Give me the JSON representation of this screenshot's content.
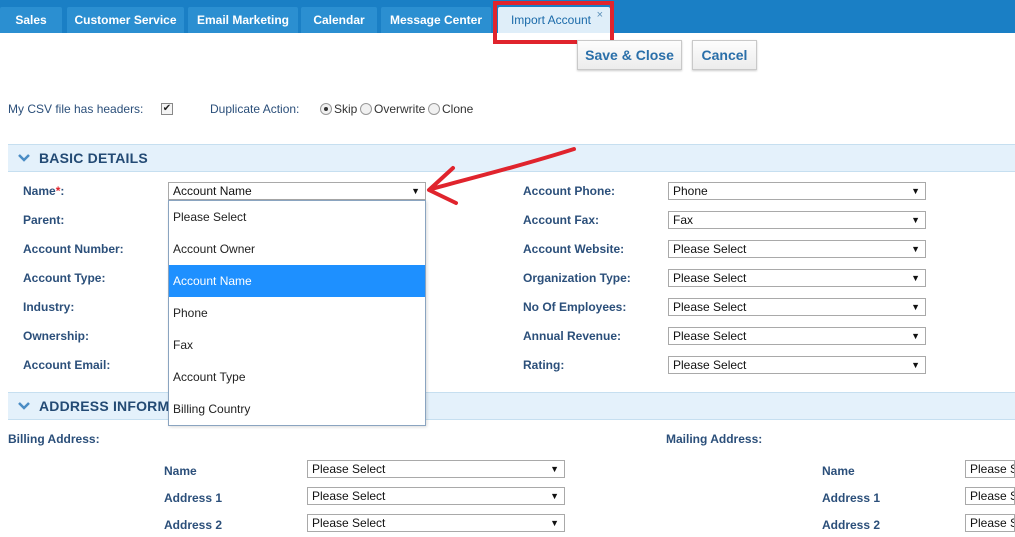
{
  "tabs": [
    {
      "label": "Sales"
    },
    {
      "label": "Customer Service"
    },
    {
      "label": "Email Marketing"
    },
    {
      "label": "Calendar"
    },
    {
      "label": "Message Center"
    },
    {
      "label": "Import Account",
      "close": "×",
      "active": true
    }
  ],
  "toolbar": {
    "save_label": "Save & Close",
    "cancel_label": "Cancel"
  },
  "options": {
    "csv_headers_label": "My CSV file has headers:",
    "csv_headers_checked": true,
    "duplicate_label": "Duplicate Action:",
    "duplicate_choices": [
      "Skip",
      "Overwrite",
      "Clone"
    ],
    "duplicate_selected": "Skip"
  },
  "basic": {
    "title": "BASIC DETAILS",
    "left_fields": [
      {
        "label": "Name",
        "required": "*",
        "colon": ":",
        "value": "Account Name"
      },
      {
        "label": "Parent:"
      },
      {
        "label": "Account Number:"
      },
      {
        "label": "Account Type:"
      },
      {
        "label": "Industry:"
      },
      {
        "label": "Ownership:"
      },
      {
        "label": "Account Email:"
      }
    ],
    "right_fields": [
      {
        "label": "Account Phone:",
        "value": "Phone"
      },
      {
        "label": "Account Fax:",
        "value": "Fax"
      },
      {
        "label": "Account Website:",
        "value": "Please Select"
      },
      {
        "label": "Organization Type:",
        "value": "Please Select"
      },
      {
        "label": "No Of Employees:",
        "value": "Please Select"
      },
      {
        "label": "Annual Revenue:",
        "value": "Please Select"
      },
      {
        "label": "Rating:",
        "value": "Please Select"
      }
    ]
  },
  "dropdown": {
    "options": [
      "Please Select",
      "Account Owner",
      "Account Name",
      "Phone",
      "Fax",
      "Account Type",
      "Billing Country"
    ],
    "selected": "Account Name"
  },
  "address": {
    "title": "ADDRESS INFORMA",
    "billing_label": "Billing Address:",
    "mailing_label": "Mailing Address:",
    "billing_fields": [
      {
        "label": "Name",
        "value": "Please Select"
      },
      {
        "label": "Address 1",
        "value": "Please Select"
      },
      {
        "label": "Address 2",
        "value": "Please Select"
      }
    ],
    "mailing_fields": [
      {
        "label": "Name",
        "value": "Please S"
      },
      {
        "label": "Address 1",
        "value": "Please S"
      },
      {
        "label": "Address 2",
        "value": "Please S"
      }
    ]
  },
  "colors": {
    "tabbar": "#1a7fc5",
    "section_bg": "#e4f1fb",
    "highlight": "#e0242d",
    "selected_option": "#1e90ff",
    "label": "#2b4f7a"
  },
  "icons": {
    "section_toggle": "chevron-down-icon",
    "select_arrow": "triangle-down-icon",
    "annotation": "red-arrow-icon"
  }
}
